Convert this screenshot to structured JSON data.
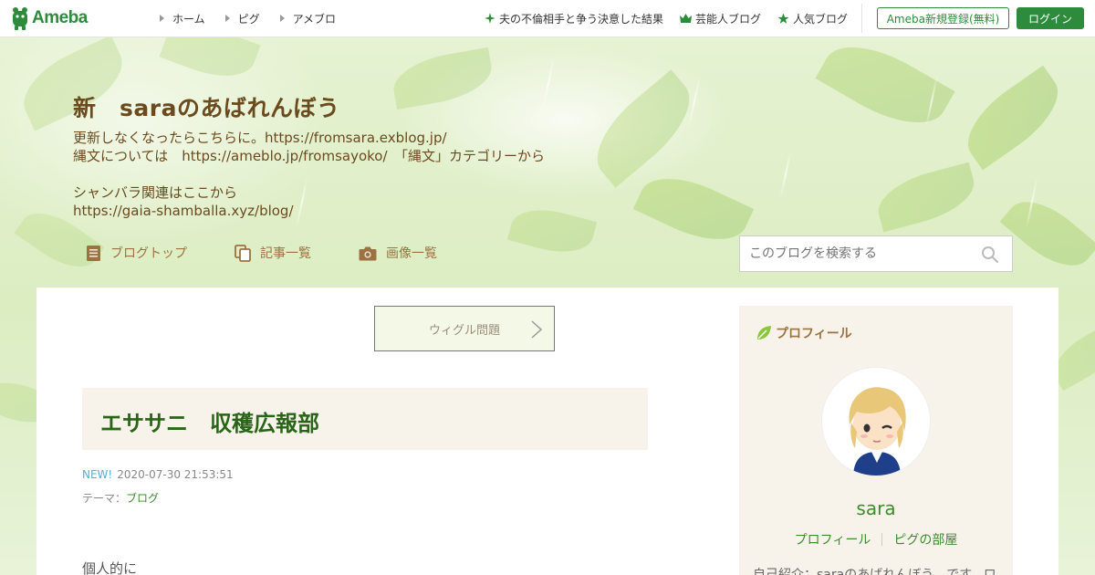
{
  "topnav": {
    "logo": "Ameba",
    "links": [
      "ホーム",
      "ピグ",
      "アメブロ"
    ],
    "right_links": [
      "夫の不倫相手と争う決意した結果",
      "芸能人ブログ",
      "人気ブログ"
    ],
    "register": "Ameba新規登録(無料)",
    "login": "ログイン"
  },
  "header": {
    "title": "新　saraのあばれんぼう",
    "description": "更新しなくなったらこちらに。https://fromsara.exblog.jp/\n縄文については　https://ameblo.jp/fromsayoko/　「縄文」カテゴリーから\n\nシャンバラ関連はここから\nhttps://gaia-shamballa.xyz/blog/",
    "nav": [
      "ブログトップ",
      "記事一覧",
      "画像一覧"
    ],
    "search_placeholder": "このブログを検索する"
  },
  "entry": {
    "theme_button": "ウィグル問題",
    "title": "エササニ　収穫広報部",
    "new_label": "NEW!",
    "datetime": "2020-07-30 21:53:51",
    "theme_prefix": "テーマ：",
    "theme": "ブログ",
    "body_start": "個人的に"
  },
  "sidebar": {
    "heading": "プロフィール",
    "name": "sara",
    "links": [
      "プロフィール",
      "ピグの部屋"
    ],
    "intro": "自己紹介：saraのあばれんぼう　です。ロ"
  },
  "colors": {
    "accent": "#2d8c3c",
    "title_brown": "#6b4a1e",
    "nav_brown": "#9b7240"
  }
}
